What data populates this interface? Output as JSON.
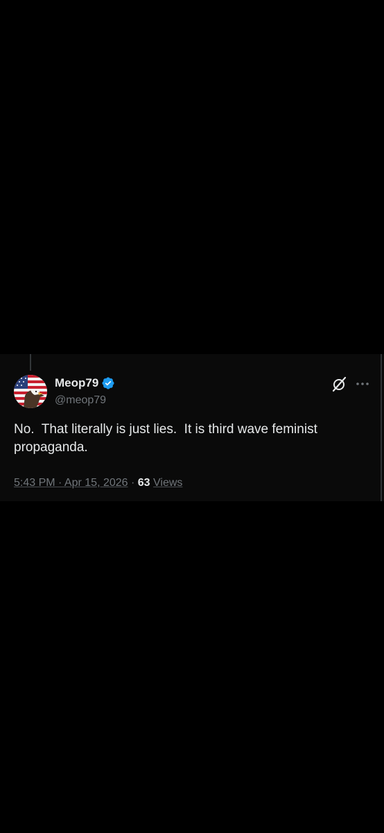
{
  "tweet": {
    "author": {
      "display_name": "Meop79",
      "handle": "@meop79",
      "verified": true,
      "avatar_icon": "eagle-flag-avatar"
    },
    "text": "No.  That literally is just lies.  It is third wave feminist propaganda.",
    "timestamp": "5:43 PM · Apr 15, 2026",
    "separator": "·",
    "views_count": "63",
    "views_label": "Views"
  },
  "icons": {
    "verified": "verified-badge-icon",
    "grok": "grok-icon",
    "more": "more-options-icon"
  },
  "colors": {
    "background": "#000000",
    "card_background": "#0a0a0a",
    "primary_text": "#e7e9ea",
    "secondary_text": "#71767b",
    "verified_blue": "#1d9bf0"
  }
}
